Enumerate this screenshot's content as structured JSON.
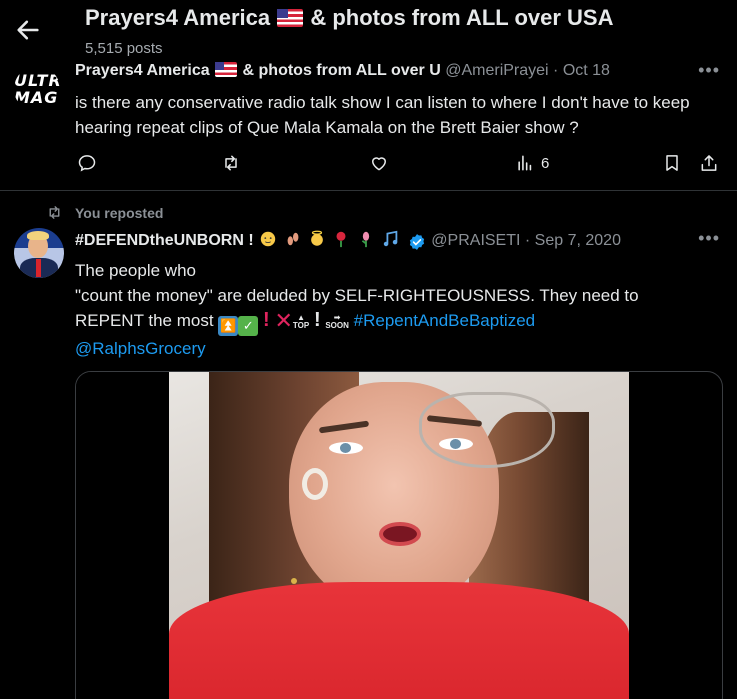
{
  "header": {
    "title_before_flag": "Prayers4 America",
    "title_after_flag": "& photos from ALL over USA",
    "post_count": "5,515 posts"
  },
  "tweet1": {
    "avatar_text_line1": "ULTRA",
    "avatar_text_line2": "MAGA",
    "author_name_before_flag": "Prayers4 America",
    "author_name_after_flag": "& photos from ALL over U",
    "handle": "@AmeriPrayei",
    "date": "· Oct 18",
    "more": "•••",
    "text": "is there any conservative radio talk  show I can listen to where I don't have to keep hearing repeat clips of Que Mala Kamala on the Brett Baier show ?",
    "views": "6",
    "icons": [
      "reply-icon",
      "repost-icon",
      "like-icon",
      "views-icon",
      "bookmark-icon",
      "share-icon"
    ]
  },
  "tweet2": {
    "repost_label": "You reposted",
    "author_name": "#DEFENDtheUNBORN !",
    "handle": "@PRAISETI",
    "date": "· Sep 7, 2020",
    "more": "•••",
    "line1": "The people who",
    "line2": "\"count the money\" are deluded by SELF-RIGHTEOUSNESS. They need to",
    "line3_start": "REPENT the most",
    "top_label": "TOP",
    "soon_label": "SOON",
    "hashtag": "#RepentAndBeBaptized",
    "mention": "@RalphsGrocery"
  },
  "colors": {
    "background": "#000000",
    "text": "#e7e9ea",
    "muted": "#8b9096",
    "link": "#1d9bf0",
    "divider": "#2f3336"
  }
}
